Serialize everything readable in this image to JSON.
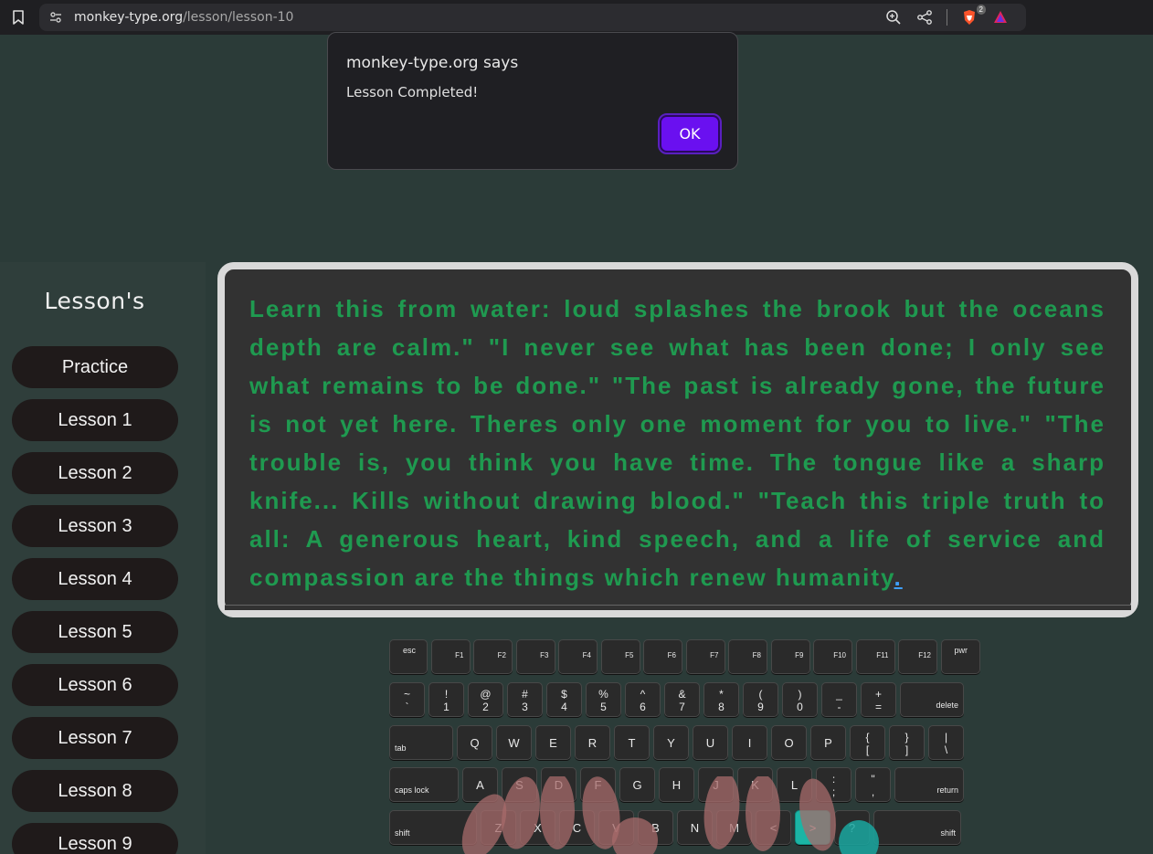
{
  "browser": {
    "url_host": "monkey-type.org",
    "url_path": "/lesson/lesson-10",
    "shield_badge": "2"
  },
  "dialog": {
    "title": "monkey-type.org says",
    "message": "Lesson Completed!",
    "ok_label": "OK"
  },
  "sidebar": {
    "title": "Lesson's",
    "items": [
      {
        "label": "Practice"
      },
      {
        "label": "Lesson 1"
      },
      {
        "label": "Lesson 2"
      },
      {
        "label": "Lesson 3"
      },
      {
        "label": "Lesson 4"
      },
      {
        "label": "Lesson 5"
      },
      {
        "label": "Lesson 6"
      },
      {
        "label": "Lesson 7"
      },
      {
        "label": "Lesson 8"
      },
      {
        "label": "Lesson 9"
      }
    ]
  },
  "lesson": {
    "text": "Learn this from water: loud splashes the brook but the oceans depth are calm.\" \"I never see what has been done; I only see what remains to be done.\" \"The past is already gone, the future is not yet here. Theres only one moment for you to live.\" \"The trouble is, you think you have time. The tongue like a sharp knife... Kills without drawing blood.\" \"Teach this triple truth to all: A generous heart, kind speech, and a life of service and compassion are the things which renew humanity",
    "cursor_char": "."
  },
  "keyboard": {
    "active_key": ">",
    "rows": [
      [
        {
          "main": "esc",
          "style": "tl"
        },
        {
          "main": "F1",
          "style": "fn"
        },
        {
          "main": "F2",
          "style": "fn"
        },
        {
          "main": "F3",
          "style": "fn"
        },
        {
          "main": "F4",
          "style": "fn"
        },
        {
          "main": "F5",
          "style": "fn"
        },
        {
          "main": "F6",
          "style": "fn"
        },
        {
          "main": "F7",
          "style": "fn"
        },
        {
          "main": "F8",
          "style": "fn"
        },
        {
          "main": "F9",
          "style": "fn"
        },
        {
          "main": "F10",
          "style": "fn"
        },
        {
          "main": "F11",
          "style": "fn"
        },
        {
          "main": "F12",
          "style": "fn"
        },
        {
          "main": "pwr",
          "style": "tl"
        }
      ],
      [
        {
          "top": "~",
          "bot": "`"
        },
        {
          "top": "!",
          "bot": "1"
        },
        {
          "top": "@",
          "bot": "2"
        },
        {
          "top": "#",
          "bot": "3"
        },
        {
          "top": "$",
          "bot": "4"
        },
        {
          "top": "%",
          "bot": "5"
        },
        {
          "top": "^",
          "bot": "6"
        },
        {
          "top": "&",
          "bot": "7"
        },
        {
          "top": "*",
          "bot": "8"
        },
        {
          "top": "(",
          "bot": "9"
        },
        {
          "top": ")",
          "bot": "0"
        },
        {
          "top": "_",
          "bot": "-"
        },
        {
          "top": "+",
          "bot": "="
        },
        {
          "main": "delete",
          "style": "r"
        }
      ],
      [
        {
          "main": "tab",
          "style": "l"
        },
        {
          "main": "Q"
        },
        {
          "main": "W"
        },
        {
          "main": "E"
        },
        {
          "main": "R"
        },
        {
          "main": "T"
        },
        {
          "main": "Y"
        },
        {
          "main": "U"
        },
        {
          "main": "I"
        },
        {
          "main": "O"
        },
        {
          "main": "P"
        },
        {
          "top": "{",
          "bot": "["
        },
        {
          "top": "}",
          "bot": "]"
        },
        {
          "top": "|",
          "bot": "\\"
        }
      ],
      [
        {
          "main": "caps lock",
          "style": "l"
        },
        {
          "main": "A"
        },
        {
          "main": "S"
        },
        {
          "main": "D"
        },
        {
          "main": "F"
        },
        {
          "main": "G"
        },
        {
          "main": "H"
        },
        {
          "main": "J"
        },
        {
          "main": "K"
        },
        {
          "main": "L"
        },
        {
          "top": ":",
          "bot": ";"
        },
        {
          "top": "\"",
          "bot": ","
        },
        {
          "main": "return",
          "style": "r"
        }
      ],
      [
        {
          "main": "shift",
          "style": "l"
        },
        {
          "main": "Z"
        },
        {
          "main": "X"
        },
        {
          "main": "C"
        },
        {
          "main": "V"
        },
        {
          "main": "B"
        },
        {
          "main": "N"
        },
        {
          "main": "M"
        },
        {
          "main": "<"
        },
        {
          "main": ">"
        },
        {
          "main": "?"
        },
        {
          "main": "shift",
          "style": "r"
        }
      ]
    ]
  }
}
